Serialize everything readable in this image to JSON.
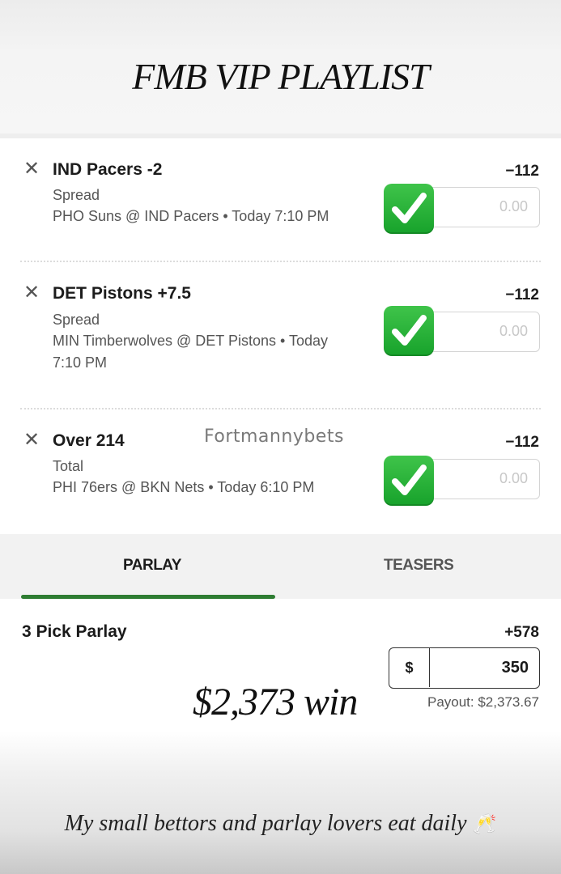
{
  "header": {
    "title": "FMB VIP PLAYLIST"
  },
  "legs": [
    {
      "selection": "IND Pacers -2",
      "market": "Spread",
      "matchup": "PHO Suns @ IND Pacers • Today 7:10 PM",
      "odds": "−112",
      "stake_placeholder": "0.00",
      "status_icon": "check-mark-icon"
    },
    {
      "selection": "DET Pistons +7.5",
      "market": "Spread",
      "matchup": "MIN Timberwolves @ DET Pistons • Today 7:10 PM",
      "odds": "−112",
      "stake_placeholder": "0.00",
      "status_icon": "check-mark-icon"
    },
    {
      "selection": "Over 214",
      "market": "Total",
      "matchup": "PHI 76ers @ BKN Nets • Today 6:10 PM",
      "odds": "−112",
      "stake_placeholder": "0.00",
      "status_icon": "check-mark-icon"
    }
  ],
  "watermark": "Fortmannybets",
  "tabs": {
    "parlay": "PARLAY",
    "teasers": "TEASERS",
    "active": "parlay"
  },
  "parlay": {
    "title": "3 Pick Parlay",
    "odds": "+578",
    "currency": "$",
    "wager": "350",
    "payout": "Payout: $2,373.67"
  },
  "captions": {
    "win": "$2,373 win",
    "footer": "My small bettors and parlay lovers eat daily",
    "footer_emoji": "🥂"
  },
  "colors": {
    "accent_green": "#2e7d32",
    "check_green": "#17a22b"
  }
}
